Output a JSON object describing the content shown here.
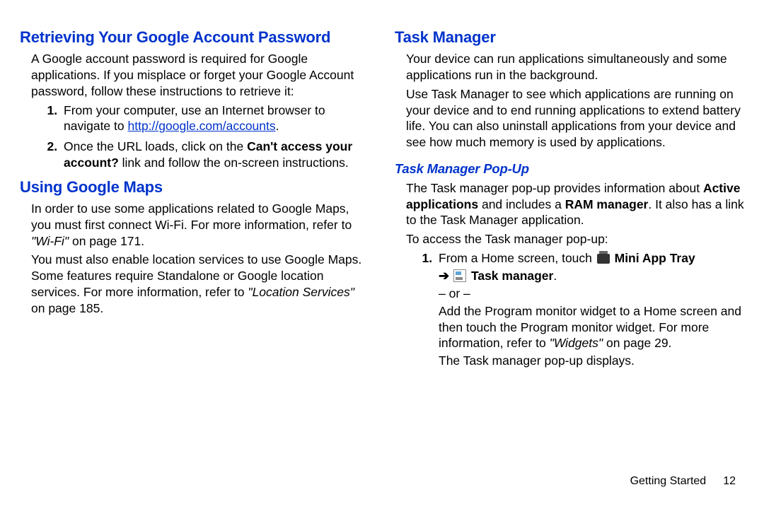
{
  "left": {
    "h1": "Retrieving Your Google Account Password",
    "p1": "A Google account password is required for Google applications. If you misplace or forget your Google Account password, follow these instructions to retrieve it:",
    "step1_a": "From your computer, use an Internet browser to navigate to ",
    "step1_link": "http://google.com/accounts",
    "step1_b": ".",
    "step2_a": "Once the URL loads, click on the ",
    "step2_bold": "Can't access your account?",
    "step2_b": " link and follow the on-screen instructions.",
    "h2": "Using Google Maps",
    "p2_a": "In order to use some applications related to Google Maps, you must first connect Wi-Fi. For more information, refer to ",
    "p2_ref": "\"Wi-Fi\"",
    "p2_b": " on page 171.",
    "p3_a": "You must also enable location services to use Google Maps. Some features require Standalone or Google location services. For more information, refer to ",
    "p3_ref": "\"Location Services\"",
    "p3_b": " on page 185."
  },
  "right": {
    "h1": "Task Manager",
    "p1": "Your device can run applications simultaneously and some applications run in the background.",
    "p2": "Use Task Manager to see which applications are running on your device and to end running applications to extend battery life. You can also uninstall applications from your device and see how much memory is used by applications.",
    "h2": "Task Manager Pop-Up",
    "p3_a": "The Task manager pop-up provides information about ",
    "p3_b1": "Active applications",
    "p3_b": " and includes a ",
    "p3_b2": "RAM manager",
    "p3_c": ". It also has a link to the Task Manager application.",
    "p4": "To access the Task manager pop-up:",
    "step1_a": "From a Home screen, touch ",
    "step1_b": " Mini App Tray",
    "step1_arrow": "➔",
    "step1_c": " Task manager",
    "step1_d": ".",
    "step1_or": "– or –",
    "step1_e_a": "Add the Program monitor widget to a Home screen and then touch the Program monitor widget. For more information, refer to ",
    "step1_e_ref": "\"Widgets\"",
    "step1_e_b": " on page 29.",
    "p5": "The Task manager pop-up displays."
  },
  "footer": {
    "section": "Getting Started",
    "page": "12"
  }
}
